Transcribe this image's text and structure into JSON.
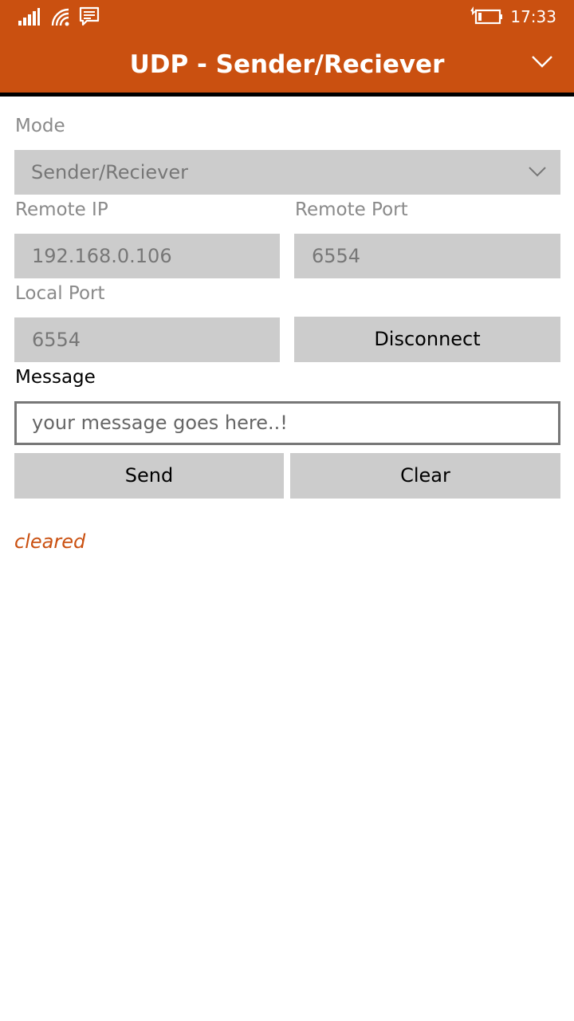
{
  "status_bar": {
    "time": "17:33",
    "icons": [
      "signal-icon",
      "wifi-icon",
      "message-icon",
      "battery-icon"
    ]
  },
  "header": {
    "title": "UDP - Sender/Reciever",
    "accent": "#ca5010"
  },
  "form": {
    "mode_label": "Mode",
    "mode_value": "Sender/Reciever",
    "remote_ip_label": "Remote IP",
    "remote_ip_value": "192.168.0.106",
    "remote_port_label": "Remote Port",
    "remote_port_value": "6554",
    "local_port_label": "Local Port",
    "local_port_value": "6554",
    "disconnect_label": "Disconnect",
    "message_label": "Message",
    "message_value": "your message goes here..!",
    "send_label": "Send",
    "clear_label": "Clear"
  },
  "status": {
    "text": "cleared",
    "color": "#ca5010"
  }
}
